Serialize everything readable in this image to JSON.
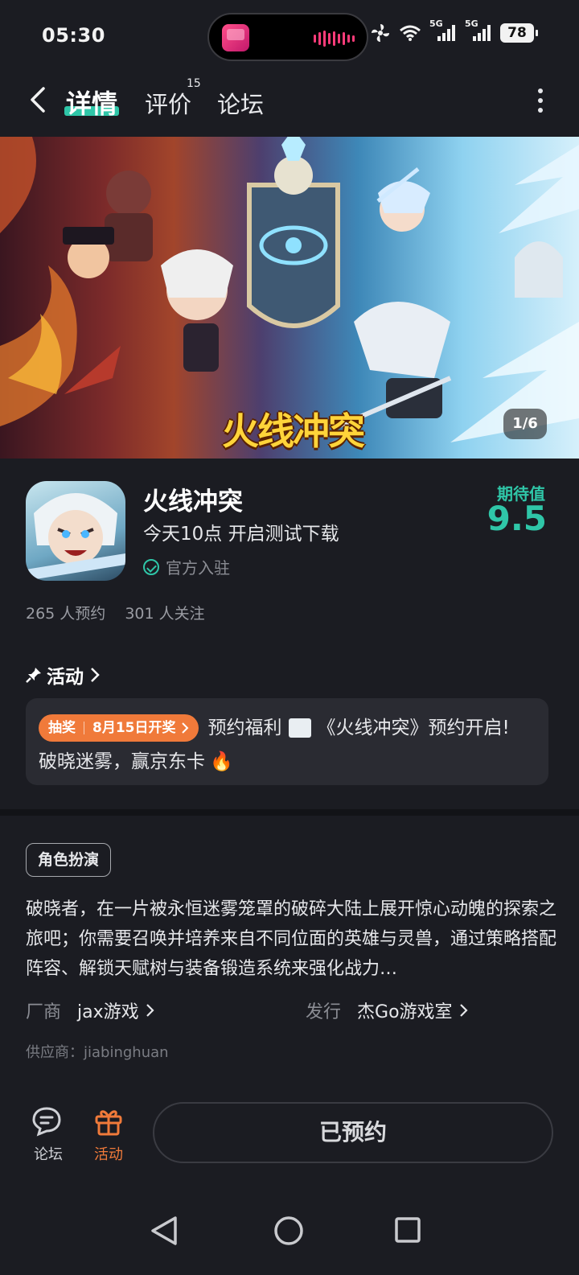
{
  "status": {
    "time": "05:30",
    "network_1": "5G",
    "network_2": "5G",
    "battery": "78"
  },
  "nav": {
    "tabs": [
      "详情",
      "评价",
      "论坛"
    ],
    "review_count": "15",
    "accent_color": "#2fc6a8"
  },
  "banner": {
    "title": "火线冲突",
    "counter": "1/6"
  },
  "app": {
    "name": "火线冲突",
    "subtitle": "今天10点 开启测试下载",
    "official": "官方入驻",
    "score_label": "期待值",
    "score": "9.5",
    "reservations": "265 人预约",
    "followers": "301 人关注"
  },
  "activity": {
    "heading": "活动",
    "badge_left": "抽奖",
    "badge_right": "8月15日开奖",
    "line1_text_a": "预约福利",
    "line1_text_b": "《火线冲突》预约开启!",
    "line2_text": "破晓迷雾，赢京东卡",
    "emoji": "🔥",
    "badge_color": "#f07a3a"
  },
  "details": {
    "genre": "角色扮演",
    "description": "破晓者，在一片被永恒迷雾笼罩的破碎大陆上展开惊心动魄的探索之旅吧；你需要召唤并培养来自不同位面的英雄与灵兽，通过策略搭配阵容、解锁天赋树与装备锻造系统来强化战力…",
    "developer_label": "厂商",
    "developer": "jax游戏",
    "publisher_label": "发行",
    "publisher": "杰Go游戏室",
    "supplier": "供应商：jiabinghuan"
  },
  "bottom": {
    "forum_label": "论坛",
    "activity_label": "活动",
    "reserve_label": "已预约",
    "activity_color": "#f07a3a"
  }
}
